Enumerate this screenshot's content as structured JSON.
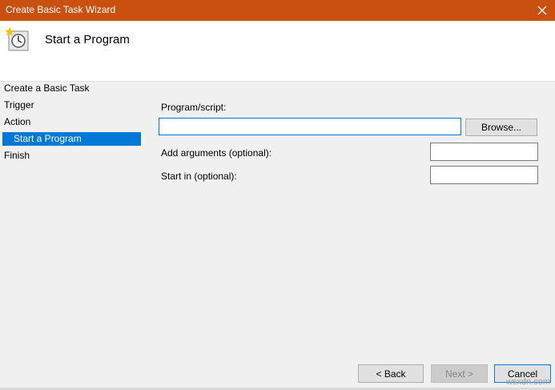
{
  "window": {
    "title": "Create Basic Task Wizard"
  },
  "header": {
    "title": "Start a Program",
    "icon": "task-scheduler-clock-icon"
  },
  "nav": {
    "items": [
      {
        "label": "Create a Basic Task",
        "selected": false
      },
      {
        "label": "Trigger",
        "selected": false
      },
      {
        "label": "Action",
        "selected": false
      },
      {
        "label": "Start a Program",
        "selected": true
      },
      {
        "label": "Finish",
        "selected": false
      }
    ]
  },
  "form": {
    "program_label": "Program/script:",
    "program_value": "",
    "browse_label": "Browse...",
    "arguments_label": "Add arguments (optional):",
    "arguments_value": "",
    "start_in_label": "Start in (optional):",
    "start_in_value": ""
  },
  "buttons": {
    "back": "< Back",
    "next": "Next >",
    "cancel": "Cancel"
  },
  "watermark": "wsxdn.com",
  "colors": {
    "titlebar": "#ca5010",
    "selection": "#0078d7"
  }
}
